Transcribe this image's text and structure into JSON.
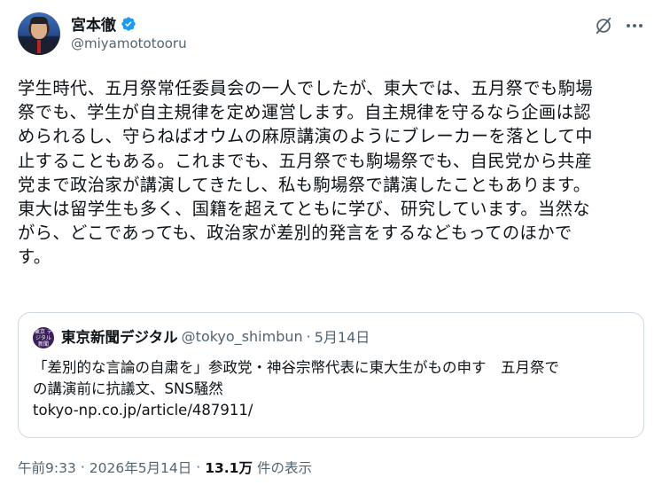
{
  "author": {
    "name": "宮本徹",
    "handle": "@miyamototooru",
    "verified": true,
    "verified_color": "#1d9bf0"
  },
  "tweet": {
    "lines": [
      "学生時代、五月祭常任委員会の一人でしたが、東大では、五月祭でも駒場",
      "祭でも、学生が自主規律を定め運営します。自主規律を守るなら企画は認",
      "められるし、守らねばオウムの麻原講演のようにブレーカーを落として中",
      "止することもある。これまでも、五月祭でも駒場祭でも、自民党から共産",
      "党まで政治家が講演してきたし、私も駒場祭で講演したこともあります。",
      "東大は留学生も多く、国籍を超えてともに学び、研究しています。当然な",
      "がら、どこであっても、政治家が差別的発言をするなどもってのほかで",
      "す。"
    ]
  },
  "quote": {
    "avatar_text": "東京 デジタル 新聞",
    "name": "東京新聞デジタル",
    "handle": "@tokyo_shimbun",
    "separator": "·",
    "date": "5月14日",
    "lines": [
      "「差別的な言論の自粛を」参政党・神谷宗幣代表に東大生がもの申す　五月祭で",
      "の講演前に抗議文、SNS騒然",
      "tokyo-np.co.jp/article/487911/"
    ]
  },
  "meta": {
    "time": "午前9:33",
    "separator": "·",
    "date": "2026年5月14日",
    "separator2": "·",
    "views_count": "13.1万",
    "views_label": "件の表示"
  },
  "icons": {
    "top_right_1": "grok-icon",
    "top_right_2": "more-icon"
  },
  "colors": {
    "text": "#0f1419",
    "secondary": "#536471",
    "border": "#cfd9de",
    "accent": "#1d9bf0"
  }
}
